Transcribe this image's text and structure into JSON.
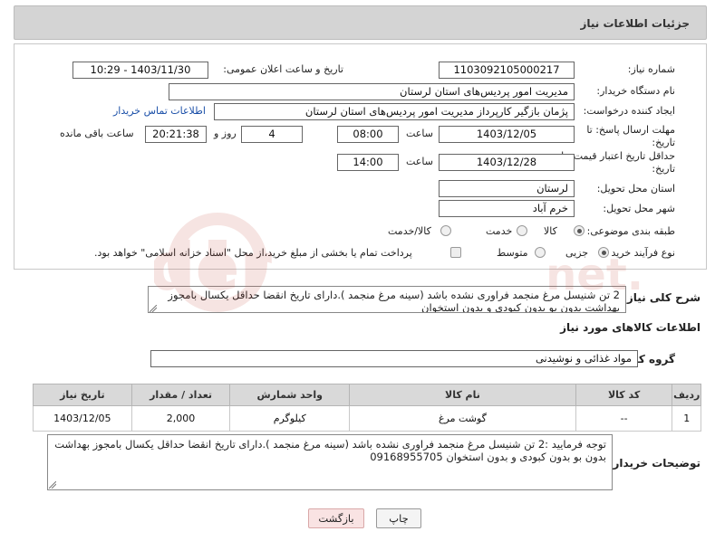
{
  "header": {
    "title": "جزئیات اطلاعات نیاز"
  },
  "fields": {
    "need_number": {
      "label": "شماره نیاز:",
      "value": "1103092105000217"
    },
    "announce_datetime": {
      "label": "تاریخ و ساعت اعلان عمومی:",
      "value": "1403/11/30 - 10:29"
    },
    "buyer_org": {
      "label": "نام دستگاه خریدار:",
      "value": "مدیریت امور پردیس‌های استان لرستان"
    },
    "requester": {
      "label": "ایجاد کننده درخواست:",
      "value": "پژمان بازگیر کارپرداز  مدیریت امور پردیس‌های استان لرستان",
      "contact_link": "اطلاعات تماس خریدار"
    },
    "reply_deadline": {
      "label_line1": "مهلت ارسال پاسخ: تا",
      "label_line2": "تاریخ:",
      "date": "1403/12/05",
      "time_label": "ساعت",
      "time": "08:00",
      "days": "4",
      "days_label": "روز و",
      "remaining": "20:21:38",
      "remaining_label": "ساعت باقی مانده"
    },
    "price_validity": {
      "label_line1": "حداقل تاریخ اعتبار قیمت: تا",
      "label_line2": "تاریخ:",
      "date": "1403/12/28",
      "time_label": "ساعت",
      "time": "14:00"
    },
    "delivery_province": {
      "label": "استان محل تحویل:",
      "value": "لرستان"
    },
    "delivery_city": {
      "label": "شهر محل تحویل:",
      "value": "خرم آباد"
    },
    "category": {
      "label": "طبقه بندی موضوعی:",
      "options": [
        "کالا",
        "خدمت",
        "کالا/خدمت"
      ],
      "selected": "کالا"
    },
    "purchase_type": {
      "label": "نوع فرآیند خرید :",
      "options": [
        "جزیی",
        "متوسط"
      ],
      "selected": "جزیی",
      "payment_note": "پرداخت تمام یا بخشی از مبلغ خرید،از محل \"اسناد خزانه اسلامی\" خواهد بود."
    }
  },
  "description": {
    "label": "شرح کلی نیاز:",
    "text": "2 تن شنیسل مرغ منجمد فراوری نشده باشد (سینه مرغ منجمد ).دارای تاریخ انقضا حداقل یکسال بامجوز بهداشت بدون بو بدون کبودی و بدون استخوان"
  },
  "goods_section": {
    "title": "اطلاعات کالاهای مورد نیاز",
    "group_label": "گروه کالا:",
    "group_value": "مواد غذائی و نوشیدنی"
  },
  "table": {
    "headers": [
      "ردیف",
      "کد کالا",
      "نام کالا",
      "واحد شمارش",
      "تعداد / مقدار",
      "تاریخ نیاز"
    ],
    "rows": [
      [
        "1",
        "--",
        "گوشت مرغ",
        "کیلوگرم",
        "2,000",
        "1403/12/05"
      ]
    ]
  },
  "buyer_notes": {
    "label": "توضیحات خریدار:",
    "text": "توجه فرمایید :2 تن شنیسل مرغ منجمد فراوری نشده باشد (سینه مرغ منجمد ).دارای تاریخ انقضا حداقل یکسال بامجوز بهداشت بدون بو بدون کبودی و بدون استخوان 09168955705"
  },
  "buttons": {
    "print": "چاپ",
    "back": "بازگشت"
  },
  "colors": {
    "header_bg": "#d4d4d4",
    "link": "#1a4fa8",
    "back_button_bg": "#f9e3e3",
    "watermark": "#c0392b"
  }
}
